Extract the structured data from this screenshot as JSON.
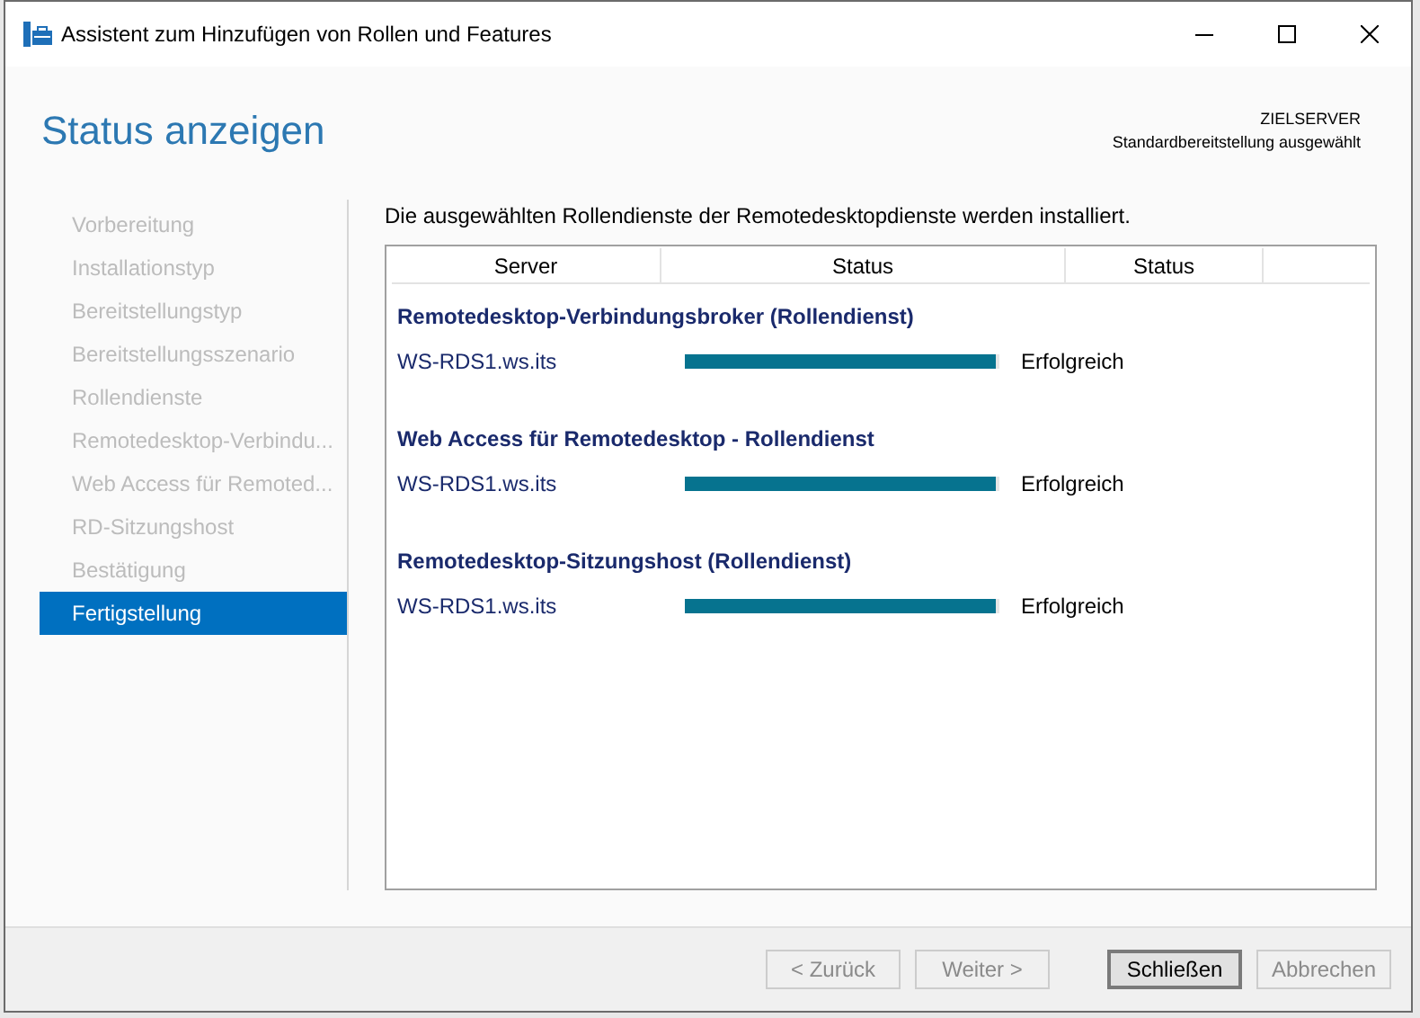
{
  "window": {
    "title": "Assistent zum Hinzufügen von Rollen und Features"
  },
  "header": {
    "title": "Status anzeigen",
    "target_label": "ZIELSERVER",
    "target_value": "Standardbereitstellung ausgewählt"
  },
  "sidebar": {
    "items": [
      {
        "label": "Vorbereitung",
        "selected": false
      },
      {
        "label": "Installationstyp",
        "selected": false
      },
      {
        "label": "Bereitstellungstyp",
        "selected": false
      },
      {
        "label": "Bereitstellungsszenario",
        "selected": false
      },
      {
        "label": "Rollendienste",
        "selected": false
      },
      {
        "label": "Remotedesktop-Verbindu...",
        "selected": false
      },
      {
        "label": "Web Access für Remoted...",
        "selected": false
      },
      {
        "label": "RD-Sitzungshost",
        "selected": false
      },
      {
        "label": "Bestätigung",
        "selected": false
      },
      {
        "label": "Fertigstellung",
        "selected": true
      }
    ]
  },
  "message": "Die ausgewählten Rollendienste der Remotedesktopdienste werden installiert.",
  "table": {
    "columns": [
      "Server",
      "Status",
      "Status"
    ],
    "groups": [
      {
        "title": "Remotedesktop-Verbindungsbroker (Rollendienst)",
        "server": "WS-RDS1.ws.its",
        "level": 0.99,
        "status": "Erfolgreich"
      },
      {
        "title": "Web Access für Remotedesktop - Rollendienst",
        "server": "WS-RDS1.ws.its",
        "level": 0.99,
        "status": "Erfolgreich"
      },
      {
        "title": "Remotedesktop-Sitzungshost (Rollendienst)",
        "server": "WS-RDS1.ws.its",
        "level": 0.99,
        "status": "Erfolgreich"
      }
    ]
  },
  "buttons": [
    {
      "label": "< Zurück",
      "disabled": true,
      "default": false
    },
    {
      "label": "Weiter >",
      "disabled": true,
      "default": false
    },
    {
      "label": "Schließen",
      "disabled": false,
      "default": true
    },
    {
      "label": "Abbrechen",
      "disabled": true,
      "default": false
    }
  ]
}
